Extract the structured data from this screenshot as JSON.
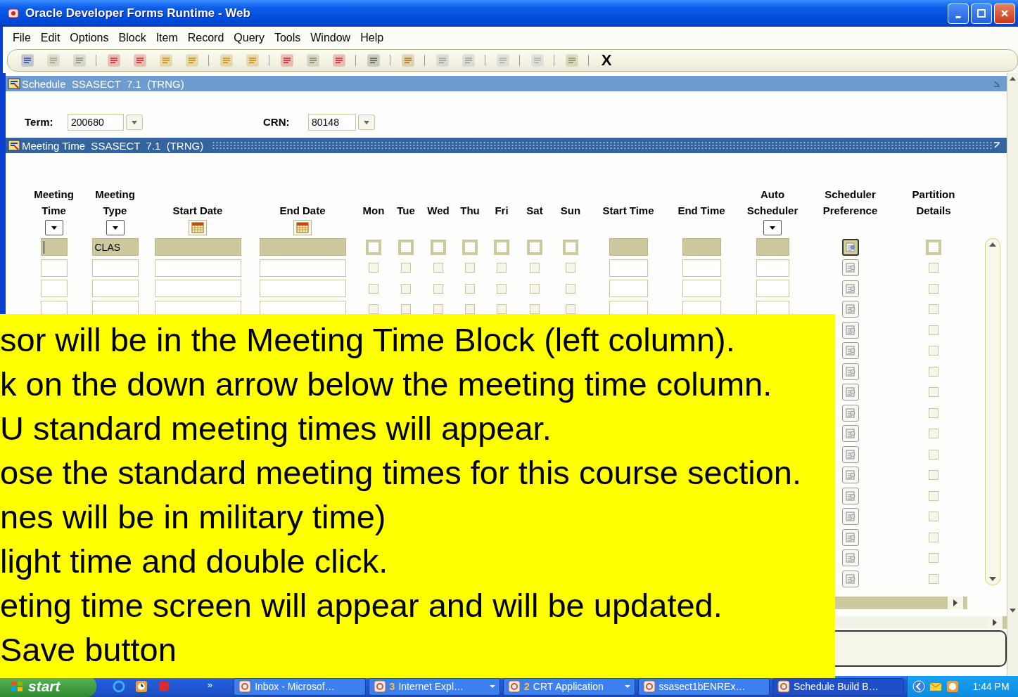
{
  "window": {
    "title": "Oracle Developer Forms Runtime - Web"
  },
  "menu": [
    {
      "label": "File"
    },
    {
      "label": "Edit"
    },
    {
      "label": "Options"
    },
    {
      "label": "Block"
    },
    {
      "label": "Item"
    },
    {
      "label": "Record"
    },
    {
      "label": "Query"
    },
    {
      "label": "Tools"
    },
    {
      "label": "Window"
    },
    {
      "label": "Help"
    }
  ],
  "toolbar": {
    "exit_label": "X"
  },
  "form_title": "Schedule  SSASECT  7.1  (TRNG)",
  "key_block": {
    "term": {
      "label": "Term:",
      "value": "200680"
    },
    "crn": {
      "label": "CRN:",
      "value": "80148"
    }
  },
  "block_title": "Meeting Time  SSASECT  7.1  (TRNG)",
  "columns": [
    {
      "label": "Meeting Time",
      "kind": "lov"
    },
    {
      "label": "Meeting Type",
      "kind": "lov"
    },
    {
      "label": "Start Date",
      "kind": "date"
    },
    {
      "label": "End Date",
      "kind": "date"
    },
    {
      "label": "Mon",
      "kind": "day"
    },
    {
      "label": "Tue",
      "kind": "day"
    },
    {
      "label": "Wed",
      "kind": "day"
    },
    {
      "label": "Thu",
      "kind": "day"
    },
    {
      "label": "Fri",
      "kind": "day"
    },
    {
      "label": "Sat",
      "kind": "day"
    },
    {
      "label": "Sun",
      "kind": "day"
    },
    {
      "label": "Start Time",
      "kind": "text"
    },
    {
      "label": "End Time",
      "kind": "text"
    },
    {
      "label": "Auto Scheduler",
      "kind": "lov"
    },
    {
      "label": "Scheduler Preference",
      "kind": "icon"
    },
    {
      "label": "Partition Details",
      "kind": "check"
    }
  ],
  "rows": [
    {
      "current": true,
      "meeting_type": "CLAS"
    },
    {
      "current": false
    },
    {
      "current": false
    },
    {
      "current": false
    },
    {
      "current": false
    },
    {
      "current": false
    },
    {
      "current": false
    },
    {
      "current": false
    },
    {
      "current": false
    },
    {
      "current": false
    },
    {
      "current": false
    },
    {
      "current": false
    },
    {
      "current": false
    },
    {
      "current": false
    },
    {
      "current": false
    },
    {
      "current": false
    },
    {
      "current": false
    }
  ],
  "overlay": {
    "lines": [
      "sor will be in the Meeting Time Block (left column).",
      "k on the down arrow below the meeting time column.",
      "U standard meeting times will appear.",
      "ose the standard meeting times for this course section.",
      "nes will be in military time)",
      "light time and double click.",
      "eting time screen will appear and will be updated.",
      "Save button"
    ]
  },
  "taskbar": {
    "start": "start",
    "more": "»",
    "tasks": [
      {
        "label": "Inbox - Microsof…",
        "grouped": false,
        "selected": false
      },
      {
        "count": "3",
        "label": "Internet Expl…",
        "grouped": true,
        "selected": false
      },
      {
        "count": "2",
        "label": "CRT Application",
        "grouped": true,
        "selected": false
      },
      {
        "label": "ssasect1bENREx…",
        "grouped": false,
        "selected": false
      },
      {
        "label": "Schedule Build B…",
        "grouped": false,
        "selected": true
      }
    ],
    "clock": "1:44 PM"
  }
}
